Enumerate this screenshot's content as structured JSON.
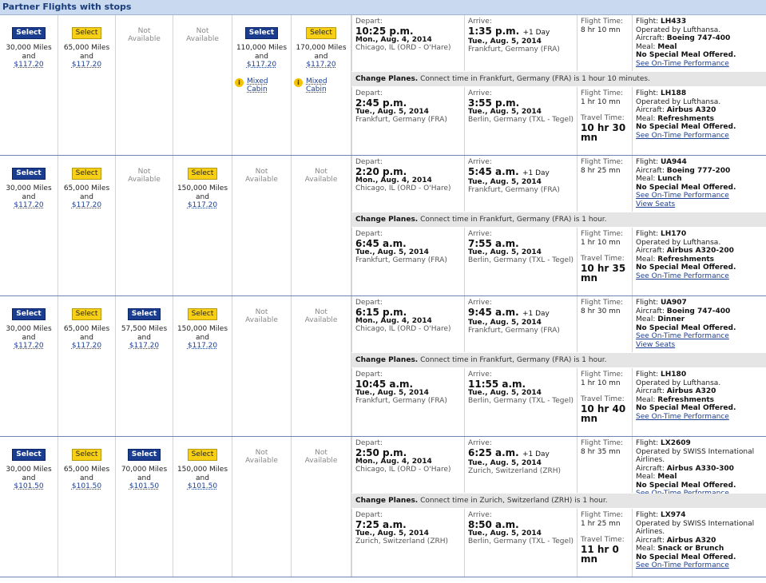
{
  "header": {
    "title": "Partner Flights with stops"
  },
  "groups": [
    {
      "fares": [
        {
          "kind": "select",
          "style": "blue",
          "label": "Select",
          "miles": "30,000 Miles",
          "and": "and",
          "price": "$117.20"
        },
        {
          "kind": "select",
          "style": "yellow",
          "label": "Select",
          "miles": "65,000 Miles",
          "and": "and",
          "price": "$117.20"
        },
        {
          "kind": "na",
          "line1": "Not",
          "line2": "Available"
        },
        {
          "kind": "na",
          "line1": "Not",
          "line2": "Available"
        },
        {
          "kind": "select",
          "style": "blue",
          "label": "Select",
          "miles": "110,000 Miles",
          "and": "and",
          "price": "$117.20",
          "mixed1": "Mixed",
          "mixed2": "Cabin"
        },
        {
          "kind": "select",
          "style": "yellow",
          "label": "Select",
          "miles": "170,000 Miles",
          "and": "and",
          "price": "$117.20",
          "mixed1": "Mixed",
          "mixed2": "Cabin"
        }
      ],
      "change": {
        "bold": "Change Planes.",
        "text": " Connect time in Frankfurt, Germany (FRA) is 1 hour 10 minutes."
      },
      "segments": [
        {
          "dep_label": "Depart:",
          "dep_time": "10:25 p.m.",
          "dep_plus": "",
          "dep_date": "Mon., Aug. 4, 2014",
          "dep_from": "Chicago, IL (ORD - O'Hare)",
          "arr_label": "Arrive:",
          "arr_time": "1:35 p.m.",
          "arr_plus": "+1 Day",
          "arr_date": "Tue., Aug. 5, 2014",
          "arr_to": "Frankfurt, Germany (FRA)",
          "ft_label": "Flight Time:",
          "ft_value": "8 hr 10 mn",
          "tt_label": "",
          "tt_value": "",
          "flight_label": "Flight:",
          "flight_no": "LH433",
          "operated": "Operated by Lufthansa.",
          "aircraft_label": "Aircraft:",
          "aircraft": "Boeing 747-400",
          "meal_label": "Meal:",
          "meal": "Meal",
          "special": "No Special Meal Offered.",
          "perf": "See On-Time Performance",
          "seats": ""
        },
        {
          "dep_label": "Depart:",
          "dep_time": "2:45 p.m.",
          "dep_plus": "",
          "dep_date": "Tue., Aug. 5, 2014",
          "dep_from": "Frankfurt, Germany (FRA)",
          "arr_label": "Arrive:",
          "arr_time": "3:55 p.m.",
          "arr_plus": "",
          "arr_date": "Tue., Aug. 5, 2014",
          "arr_to": "Berlin, Germany (TXL - Tegel)",
          "ft_label": "Flight Time:",
          "ft_value": "1 hr 10 mn",
          "tt_label": "Travel Time:",
          "tt_value": "10 hr 30 mn",
          "flight_label": "Flight:",
          "flight_no": "LH188",
          "operated": "Operated by Lufthansa.",
          "aircraft_label": "Aircraft:",
          "aircraft": "Airbus A320",
          "meal_label": "Meal:",
          "meal": "Refreshments",
          "special": "No Special Meal Offered.",
          "perf": "See On-Time Performance",
          "seats": ""
        }
      ]
    },
    {
      "fares": [
        {
          "kind": "select",
          "style": "blue",
          "label": "Select",
          "miles": "30,000 Miles",
          "and": "and",
          "price": "$117.20"
        },
        {
          "kind": "select",
          "style": "yellow",
          "label": "Select",
          "miles": "65,000 Miles",
          "and": "and",
          "price": "$117.20"
        },
        {
          "kind": "na",
          "line1": "Not",
          "line2": "Available"
        },
        {
          "kind": "select",
          "style": "yellow",
          "label": "Select",
          "miles": "150,000 Miles",
          "and": "and",
          "price": "$117.20"
        },
        {
          "kind": "na",
          "line1": "Not",
          "line2": "Available"
        },
        {
          "kind": "na",
          "line1": "Not",
          "line2": "Available"
        }
      ],
      "change": {
        "bold": "Change Planes.",
        "text": " Connect time in Frankfurt, Germany (FRA) is 1 hour."
      },
      "segments": [
        {
          "dep_label": "Depart:",
          "dep_time": "2:20 p.m.",
          "dep_plus": "",
          "dep_date": "Mon., Aug. 4, 2014",
          "dep_from": "Chicago, IL (ORD - O'Hare)",
          "arr_label": "Arrive:",
          "arr_time": "5:45 a.m.",
          "arr_plus": "+1 Day",
          "arr_date": "Tue., Aug. 5, 2014",
          "arr_to": "Frankfurt, Germany (FRA)",
          "ft_label": "Flight Time:",
          "ft_value": "8 hr 25 mn",
          "tt_label": "",
          "tt_value": "",
          "flight_label": "Flight:",
          "flight_no": "UA944",
          "operated": "",
          "aircraft_label": "Aircraft:",
          "aircraft": "Boeing 777-200",
          "meal_label": "Meal:",
          "meal": "Lunch",
          "special": "No Special Meal Offered.",
          "perf": "See On-Time Performance",
          "seats": "View Seats"
        },
        {
          "dep_label": "Depart:",
          "dep_time": "6:45 a.m.",
          "dep_plus": "",
          "dep_date": "Tue., Aug. 5, 2014",
          "dep_from": "Frankfurt, Germany (FRA)",
          "arr_label": "Arrive:",
          "arr_time": "7:55 a.m.",
          "arr_plus": "",
          "arr_date": "Tue., Aug. 5, 2014",
          "arr_to": "Berlin, Germany (TXL - Tegel)",
          "ft_label": "Flight Time:",
          "ft_value": "1 hr 10 mn",
          "tt_label": "Travel Time:",
          "tt_value": "10 hr 35 mn",
          "flight_label": "Flight:",
          "flight_no": "LH170",
          "operated": "Operated by Lufthansa.",
          "aircraft_label": "Aircraft:",
          "aircraft": "Airbus A320-200",
          "meal_label": "Meal:",
          "meal": "Refreshments",
          "special": "No Special Meal Offered.",
          "perf": "See On-Time Performance",
          "seats": ""
        }
      ]
    },
    {
      "fares": [
        {
          "kind": "select",
          "style": "blue",
          "label": "Select",
          "miles": "30,000 Miles",
          "and": "and",
          "price": "$117.20"
        },
        {
          "kind": "select",
          "style": "yellow",
          "label": "Select",
          "miles": "65,000 Miles",
          "and": "and",
          "price": "$117.20"
        },
        {
          "kind": "select",
          "style": "blue",
          "label": "Select",
          "miles": "57,500 Miles",
          "and": "and",
          "price": "$117.20"
        },
        {
          "kind": "select",
          "style": "yellow",
          "label": "Select",
          "miles": "150,000 Miles",
          "and": "and",
          "price": "$117.20"
        },
        {
          "kind": "na",
          "line1": "Not",
          "line2": "Available"
        },
        {
          "kind": "na",
          "line1": "Not",
          "line2": "Available"
        }
      ],
      "change": {
        "bold": "Change Planes.",
        "text": " Connect time in Frankfurt, Germany (FRA) is 1 hour."
      },
      "segments": [
        {
          "dep_label": "Depart:",
          "dep_time": "6:15 p.m.",
          "dep_plus": "",
          "dep_date": "Mon., Aug. 4, 2014",
          "dep_from": "Chicago, IL (ORD - O'Hare)",
          "arr_label": "Arrive:",
          "arr_time": "9:45 a.m.",
          "arr_plus": "+1 Day",
          "arr_date": "Tue., Aug. 5, 2014",
          "arr_to": "Frankfurt, Germany (FRA)",
          "ft_label": "Flight Time:",
          "ft_value": "8 hr 30 mn",
          "tt_label": "",
          "tt_value": "",
          "flight_label": "Flight:",
          "flight_no": "UA907",
          "operated": "",
          "aircraft_label": "Aircraft:",
          "aircraft": "Boeing 747-400",
          "meal_label": "Meal:",
          "meal": "Dinner",
          "special": "No Special Meal Offered.",
          "perf": "See On-Time Performance",
          "seats": "View Seats"
        },
        {
          "dep_label": "Depart:",
          "dep_time": "10:45 a.m.",
          "dep_plus": "",
          "dep_date": "Tue., Aug. 5, 2014",
          "dep_from": "Frankfurt, Germany (FRA)",
          "arr_label": "Arrive:",
          "arr_time": "11:55 a.m.",
          "arr_plus": "",
          "arr_date": "Tue., Aug. 5, 2014",
          "arr_to": "Berlin, Germany (TXL - Tegel)",
          "ft_label": "Flight Time:",
          "ft_value": "1 hr 10 mn",
          "tt_label": "Travel Time:",
          "tt_value": "10 hr 40 mn",
          "flight_label": "Flight:",
          "flight_no": "LH180",
          "operated": "Operated by Lufthansa.",
          "aircraft_label": "Aircraft:",
          "aircraft": "Airbus A320",
          "meal_label": "Meal:",
          "meal": "Refreshments",
          "special": "No Special Meal Offered.",
          "perf": "See On-Time Performance",
          "seats": ""
        }
      ]
    },
    {
      "fares": [
        {
          "kind": "select",
          "style": "blue",
          "label": "Select",
          "miles": "30,000 Miles",
          "and": "and",
          "price": "$101.50"
        },
        {
          "kind": "select",
          "style": "yellow",
          "label": "Select",
          "miles": "65,000 Miles",
          "and": "and",
          "price": "$101.50"
        },
        {
          "kind": "select",
          "style": "blue",
          "label": "Select",
          "miles": "70,000 Miles",
          "and": "and",
          "price": "$101.50"
        },
        {
          "kind": "select",
          "style": "yellow",
          "label": "Select",
          "miles": "150,000 Miles",
          "and": "and",
          "price": "$101.50"
        },
        {
          "kind": "na",
          "line1": "Not",
          "line2": "Available"
        },
        {
          "kind": "na",
          "line1": "Not",
          "line2": "Available"
        }
      ],
      "change": {
        "bold": "Change Planes.",
        "text": " Connect time in Zurich, Switzerland (ZRH) is 1 hour."
      },
      "segments": [
        {
          "dep_label": "Depart:",
          "dep_time": "2:50 p.m.",
          "dep_plus": "",
          "dep_date": "Mon., Aug. 4, 2014",
          "dep_from": "Chicago, IL (ORD - O'Hare)",
          "arr_label": "Arrive:",
          "arr_time": "6:25 a.m.",
          "arr_plus": "+1 Day",
          "arr_date": "Tue., Aug. 5, 2014",
          "arr_to": "Zurich, Switzerland (ZRH)",
          "ft_label": "Flight Time:",
          "ft_value": "8 hr 35 mn",
          "tt_label": "",
          "tt_value": "",
          "flight_label": "Flight:",
          "flight_no": "LX2609",
          "operated": "Operated by SWISS International Airlines.",
          "aircraft_label": "Aircraft:",
          "aircraft": "Airbus A330-300",
          "meal_label": "Meal:",
          "meal": "Meal",
          "special": "No Special Meal Offered.",
          "perf": "See On-Time Performance",
          "seats": ""
        },
        {
          "dep_label": "Depart:",
          "dep_time": "7:25 a.m.",
          "dep_plus": "",
          "dep_date": "Tue., Aug. 5, 2014",
          "dep_from": "Zurich, Switzerland (ZRH)",
          "arr_label": "Arrive:",
          "arr_time": "8:50 a.m.",
          "arr_plus": "",
          "arr_date": "Tue., Aug. 5, 2014",
          "arr_to": "Berlin, Germany (TXL - Tegel)",
          "ft_label": "Flight Time:",
          "ft_value": "1 hr 25 mn",
          "tt_label": "Travel Time:",
          "tt_value": "11 hr 0 mn",
          "flight_label": "Flight:",
          "flight_no": "LX974",
          "operated": "Operated by SWISS International Airlines.",
          "aircraft_label": "Aircraft:",
          "aircraft": "Airbus A320",
          "meal_label": "Meal:",
          "meal": "Snack or Brunch",
          "special": "No Special Meal Offered.",
          "perf": "See On-Time Performance",
          "seats": ""
        }
      ]
    }
  ]
}
